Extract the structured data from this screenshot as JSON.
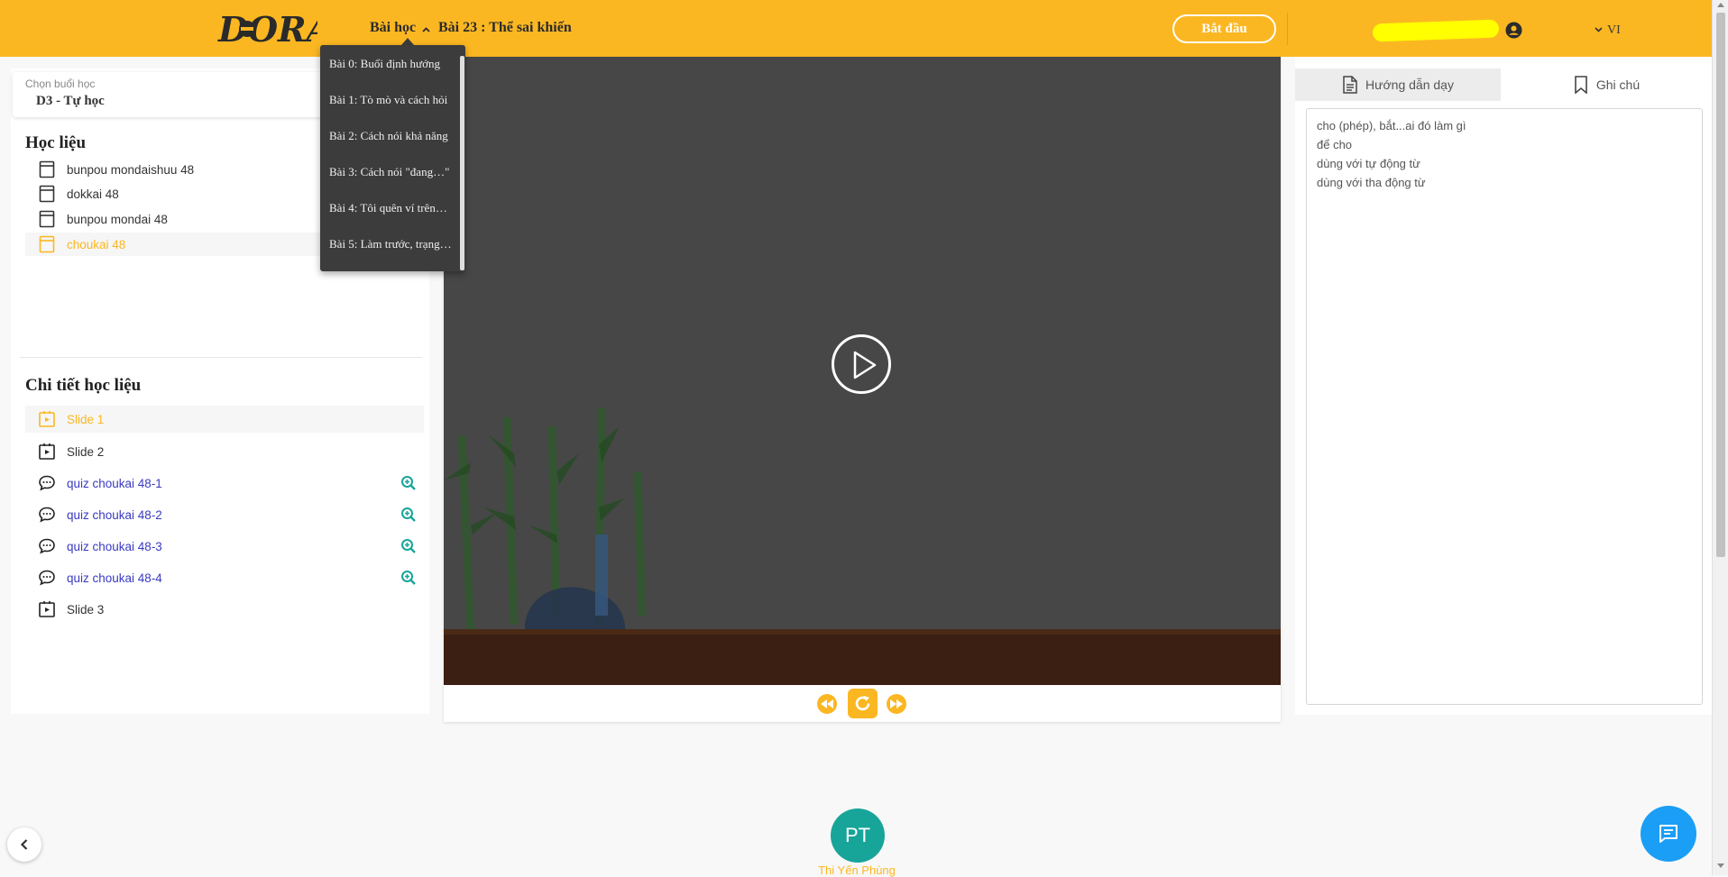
{
  "header": {
    "logo_text": "DORA",
    "lessons_label": "Bài học",
    "current_lesson": "Bài 23 : Thể sai khiến",
    "start_button": "Bắt đầu",
    "language": "VI",
    "colors": {
      "brand": "#fbb722",
      "dropdown_bg": "#3c3c3c"
    }
  },
  "dropdown": {
    "items": [
      "Bài 0: Buổi định hướng",
      "Bài 1: Tò mò và cách hỏi",
      "Bài 2: Cách nói khả năng",
      "Bài 3: Cách nói \"đang…\"",
      "Bài 4: Tôi quên ví trên…",
      "Bài 5: Làm trước, trạng…"
    ]
  },
  "left": {
    "session_label": "Chọn buổi học",
    "session_value": "D3 - Tự học",
    "materials_title": "Học liệu",
    "materials": [
      {
        "label": "bunpou mondaishuu 48",
        "icon": "book-icon",
        "active": false
      },
      {
        "label": "dokkai 48",
        "icon": "book-icon",
        "active": false
      },
      {
        "label": "bunpou mondai 48",
        "icon": "book-icon",
        "active": false
      },
      {
        "label": "choukai 48",
        "icon": "book-icon",
        "active": true
      }
    ],
    "details_title": "Chi tiết học liệu",
    "details": [
      {
        "label": "Slide 1",
        "icon": "slide-icon",
        "active": true
      },
      {
        "label": "Slide 2",
        "icon": "slide-icon",
        "active": false
      },
      {
        "label": "quiz choukai 48-1",
        "icon": "chat-bubble-icon",
        "quiz": true
      },
      {
        "label": "quiz choukai 48-2",
        "icon": "chat-bubble-icon",
        "quiz": true
      },
      {
        "label": "quiz choukai 48-3",
        "icon": "chat-bubble-icon",
        "quiz": true
      },
      {
        "label": "quiz choukai 48-4",
        "icon": "chat-bubble-icon",
        "quiz": true
      },
      {
        "label": "Slide 3",
        "icon": "slide-icon",
        "active": false
      }
    ]
  },
  "right": {
    "tab_guide": "Hướng dẫn dạy",
    "tab_notes": "Ghi chú",
    "notes": [
      "cho (phép), bắt...ai đó làm gì",
      "để cho",
      "dùng với tự động từ",
      "dùng với tha động từ"
    ]
  },
  "footer": {
    "avatar_initials": "PT",
    "user_name": "Thi Yến Phùng"
  }
}
